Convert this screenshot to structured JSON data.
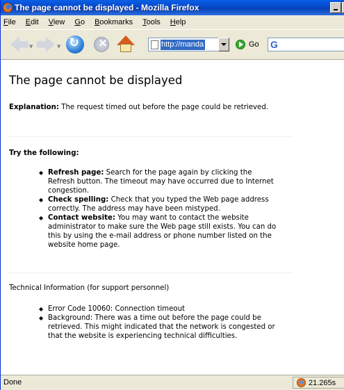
{
  "window": {
    "title": "The page cannot be displayed - Mozilla Firefox"
  },
  "menubar": {
    "items": [
      {
        "label": "File",
        "accel": "F",
        "rest": "ile"
      },
      {
        "label": "Edit",
        "accel": "E",
        "rest": "dit"
      },
      {
        "label": "View",
        "accel": "V",
        "rest": "iew"
      },
      {
        "label": "Go",
        "accel": "G",
        "rest": "o"
      },
      {
        "label": "Bookmarks",
        "accel": "B",
        "rest": "ookmarks"
      },
      {
        "label": "Tools",
        "accel": "T",
        "rest": "ools"
      },
      {
        "label": "Help",
        "accel": "H",
        "rest": "elp"
      }
    ]
  },
  "navbar": {
    "url": "http://manda",
    "go_label": "Go",
    "search_logo": "G"
  },
  "page": {
    "title": "The page cannot be displayed",
    "explanation_label": "Explanation:",
    "explanation_text": " The request timed out before the page could be retrieved.",
    "try_heading": "Try the following:",
    "suggestions": [
      {
        "label": "Refresh page:",
        "text": " Search for the page again by clicking the Refresh button. The timeout may have occurred due to Internet congestion."
      },
      {
        "label": "Check spelling:",
        "text": " Check that you typed the Web page address correctly. The address may have been mistyped."
      },
      {
        "label": "Contact website:",
        "text": " You may want to contact the website administrator to make sure the Web page still exists. You can do this by using the e-mail address or phone number listed on the website home page."
      }
    ],
    "tech_heading": "Technical Information (for support personnel)",
    "tech_items": [
      "Error Code 10060: Connection timeout",
      "Background: There was a time out before the page could be retrieved. This might indicated that the network is congested or that the website is experiencing technical difficulties."
    ]
  },
  "statusbar": {
    "text": "Done",
    "timer": "21.265s"
  }
}
